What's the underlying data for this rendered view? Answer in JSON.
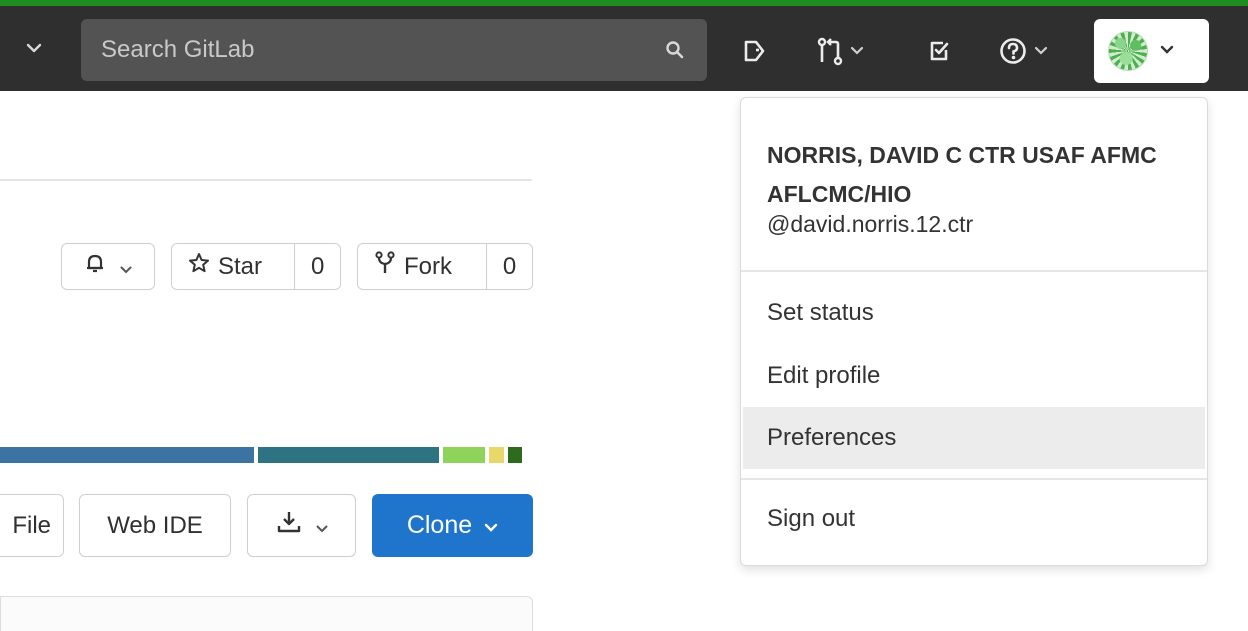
{
  "navbar": {
    "search_placeholder": "Search GitLab",
    "icons": [
      "chevron-down-icon",
      "search-icon",
      "issues-icon",
      "merge-requests-icon",
      "todos-icon",
      "help-icon",
      "avatar"
    ],
    "accent_color": "#1f8c1f",
    "background_color": "#2f2f2f"
  },
  "project": {
    "star": {
      "label": "Star",
      "count": "0"
    },
    "fork": {
      "label": "Fork",
      "count": "0"
    },
    "file_button_partial": "File",
    "web_ide_label": "Web IDE",
    "clone_label": "Clone",
    "clone_color": "#1f75cb",
    "language_bar": [
      {
        "share": 0.493,
        "color": "#3b74a3"
      },
      {
        "share": 0.35,
        "color": "#2d7382"
      },
      {
        "share": 0.082,
        "color": "#8ed35a"
      },
      {
        "share": 0.03,
        "color": "#e8d86a"
      },
      {
        "share": 0.028,
        "color": "#2f6b1c"
      }
    ]
  },
  "user_menu": {
    "full_name": "NORRIS, DAVID C CTR USAF AFMC AFLCMC/HIO",
    "username": "@david.norris.12.ctr",
    "items": [
      {
        "label": "Set status",
        "active": false
      },
      {
        "label": "Edit profile",
        "active": false
      },
      {
        "label": "Preferences",
        "active": true
      },
      {
        "label": "Sign out",
        "active": false
      }
    ]
  }
}
